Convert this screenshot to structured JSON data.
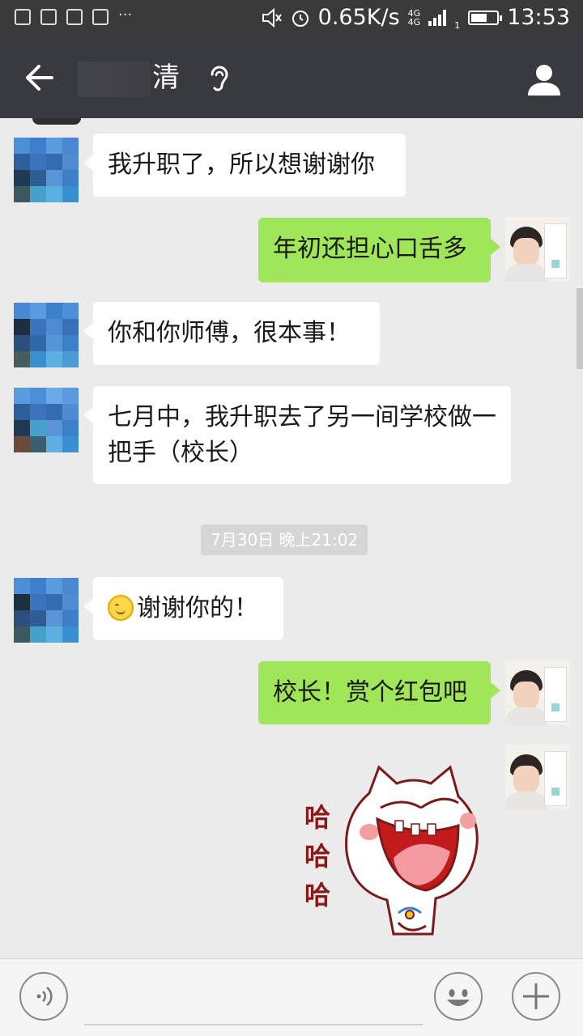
{
  "status_bar": {
    "network_speed": "0.65K/s",
    "network_type_1": "4G",
    "network_type_2": "4G",
    "sim_index": "1",
    "time": "13:53",
    "notification_more": "···"
  },
  "header": {
    "title_visible": "清"
  },
  "messages": [
    {
      "side": "left",
      "text": "我升职了，所以想谢谢你"
    },
    {
      "side": "right",
      "text": "年初还担心口舌多"
    },
    {
      "side": "left",
      "text": "你和你师傅，很本事！"
    },
    {
      "side": "left",
      "text": "七月中，我升职去了另一间学校做一把手（校长）"
    },
    {
      "side": "left",
      "text": "谢谢你的！"
    },
    {
      "side": "right",
      "text": "校长！赏个红包吧"
    }
  ],
  "timestamp": "7月30日 晚上21:02",
  "sticker": {
    "text": [
      "哈",
      "哈",
      "哈"
    ]
  },
  "colors": {
    "status_bar": "#3a3a3a",
    "title_bar": "#393a3f",
    "chat_background": "#ebebeb",
    "bubble_sent": "#9fe658",
    "bubble_received": "#ffffff"
  }
}
